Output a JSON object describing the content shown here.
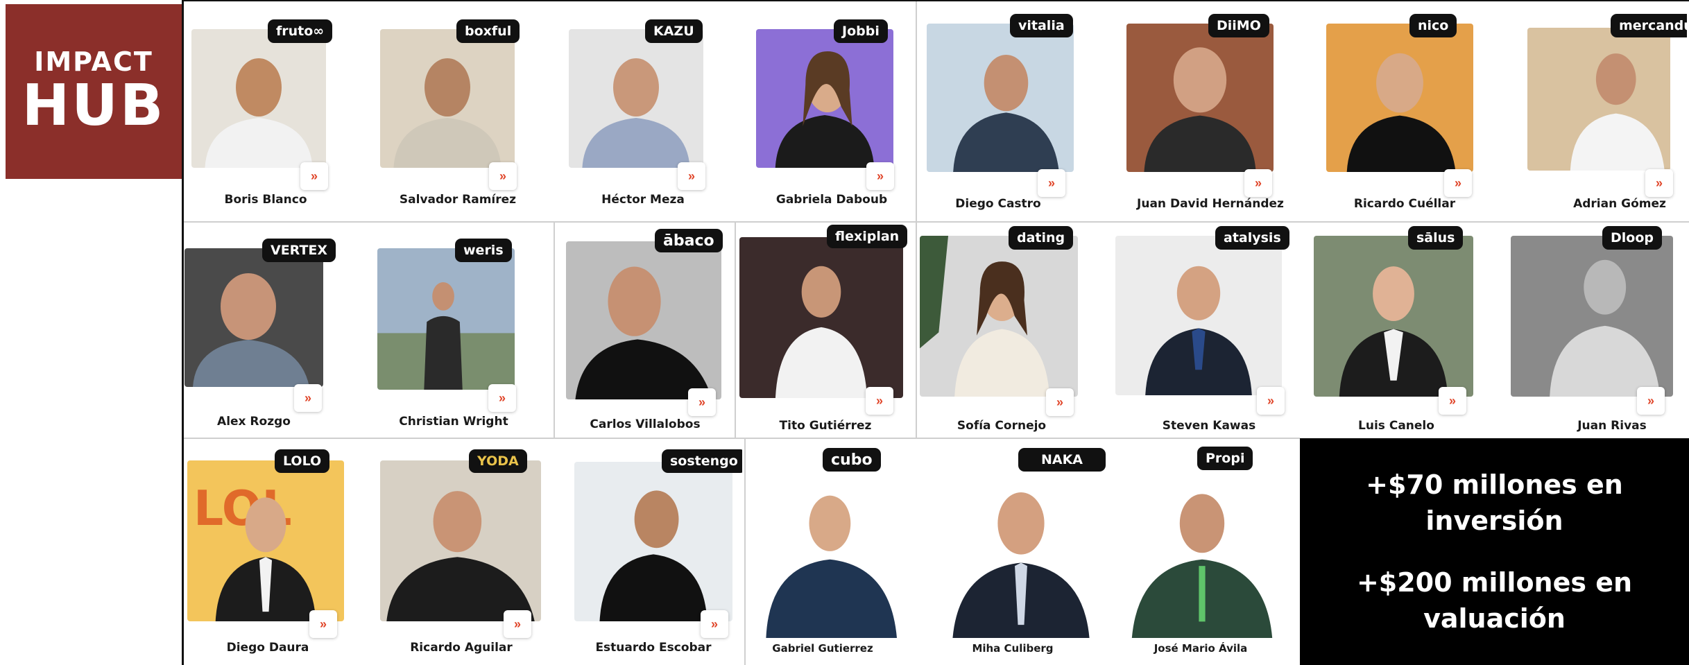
{
  "logo": {
    "line1": "IMPACT",
    "line2": "HUB"
  },
  "colors": {
    "brand": "#8b2f2a",
    "arrow": "#e0462a",
    "badge_bg": "#111111",
    "stats_bg": "#000000"
  },
  "arrow_glyph": "»",
  "founders": [
    {
      "name": "Boris Blanco",
      "company": "fruto∞",
      "photo_bg": "#e6e2da",
      "shirt": "#f2f2f2"
    },
    {
      "name": "Salvador Ramírez",
      "company": "boxful",
      "photo_bg": "#ddd3c2",
      "shirt": "#cfc8b9"
    },
    {
      "name": "Héctor Meza",
      "company": "KAZU",
      "photo_bg": "#e4e4e4",
      "shirt": "#9aa8c4"
    },
    {
      "name": "Gabriela Daboub",
      "company": "Jobbi",
      "photo_bg": "#8c6fd6",
      "shirt": "#1b1b1b"
    },
    {
      "name": "Diego Castro",
      "company": "vitalia",
      "photo_bg": "#c8d7e3",
      "shirt": "#2f3e52"
    },
    {
      "name": "Juan David Hernández",
      "company": "DiiMO",
      "photo_bg": "#9a5a3e",
      "shirt": "#2a2a2a"
    },
    {
      "name": "Ricardo Cuéllar",
      "company": "nico",
      "photo_bg": "#e4a04a",
      "shirt": "#111111"
    },
    {
      "name": "Adrian Gómez",
      "company": "mercandú",
      "photo_bg": "#d9c2a0",
      "shirt": "#f4f4f4"
    },
    {
      "name": "Alex Rozgo",
      "company": "VERTEX",
      "photo_bg": "#4a4a4a",
      "shirt": "#6f7f92"
    },
    {
      "name": "Christian Wright",
      "company": "weris",
      "photo_bg": "#9fb3c8",
      "shirt": "#2a2a2a"
    },
    {
      "name": "Carlos Villalobos",
      "company": "ābaco",
      "photo_bg": "#bdbdbd",
      "shirt": "#111111"
    },
    {
      "name": "Tito Gutiérrez",
      "company": "flexiplan",
      "photo_bg": "#3b2b2b",
      "shirt": "#f2f2f2"
    },
    {
      "name": "Sofía Cornejo",
      "company": "dating",
      "photo_bg": "#d8d8d8",
      "shirt": "#f1ebe0"
    },
    {
      "name": "Steven Kawas",
      "company": "atalysis",
      "photo_bg": "#ececec",
      "shirt": "#1c2433"
    },
    {
      "name": "Luis Canelo",
      "company": "sālus",
      "photo_bg": "#7d8c72",
      "shirt": "#1c1c1c"
    },
    {
      "name": "Juan Rivas",
      "company": "Dloop",
      "photo_bg": "#8a8a8a",
      "shirt": "#d8d8d8"
    },
    {
      "name": "Diego Daura",
      "company": "LOLO",
      "photo_bg": "#f3c55b",
      "shirt": "#1c1c1c"
    },
    {
      "name": "Ricardo Aguilar",
      "company": "YODA",
      "photo_bg": "#d7d0c4",
      "shirt": "#1c1c1c"
    },
    {
      "name": "Estuardo Escobar",
      "company": "sostengo",
      "photo_bg": "#e8ecef",
      "shirt": "#111111"
    },
    {
      "name": "Gabriel Gutierrez",
      "company": "cubo",
      "photo_bg": "#ffffff",
      "shirt": "#1f3552"
    },
    {
      "name": "Miha Culiberg",
      "company": "NAKA",
      "photo_bg": "#ffffff",
      "shirt": "#1c2433"
    },
    {
      "name": "José Mario Ávila",
      "company": "Propi",
      "photo_bg": "#ffffff",
      "shirt": "#2b4a3a"
    }
  ],
  "stats": [
    {
      "text": "+$70 millones en inversión"
    },
    {
      "text": "+$200 millones en valuación"
    }
  ]
}
